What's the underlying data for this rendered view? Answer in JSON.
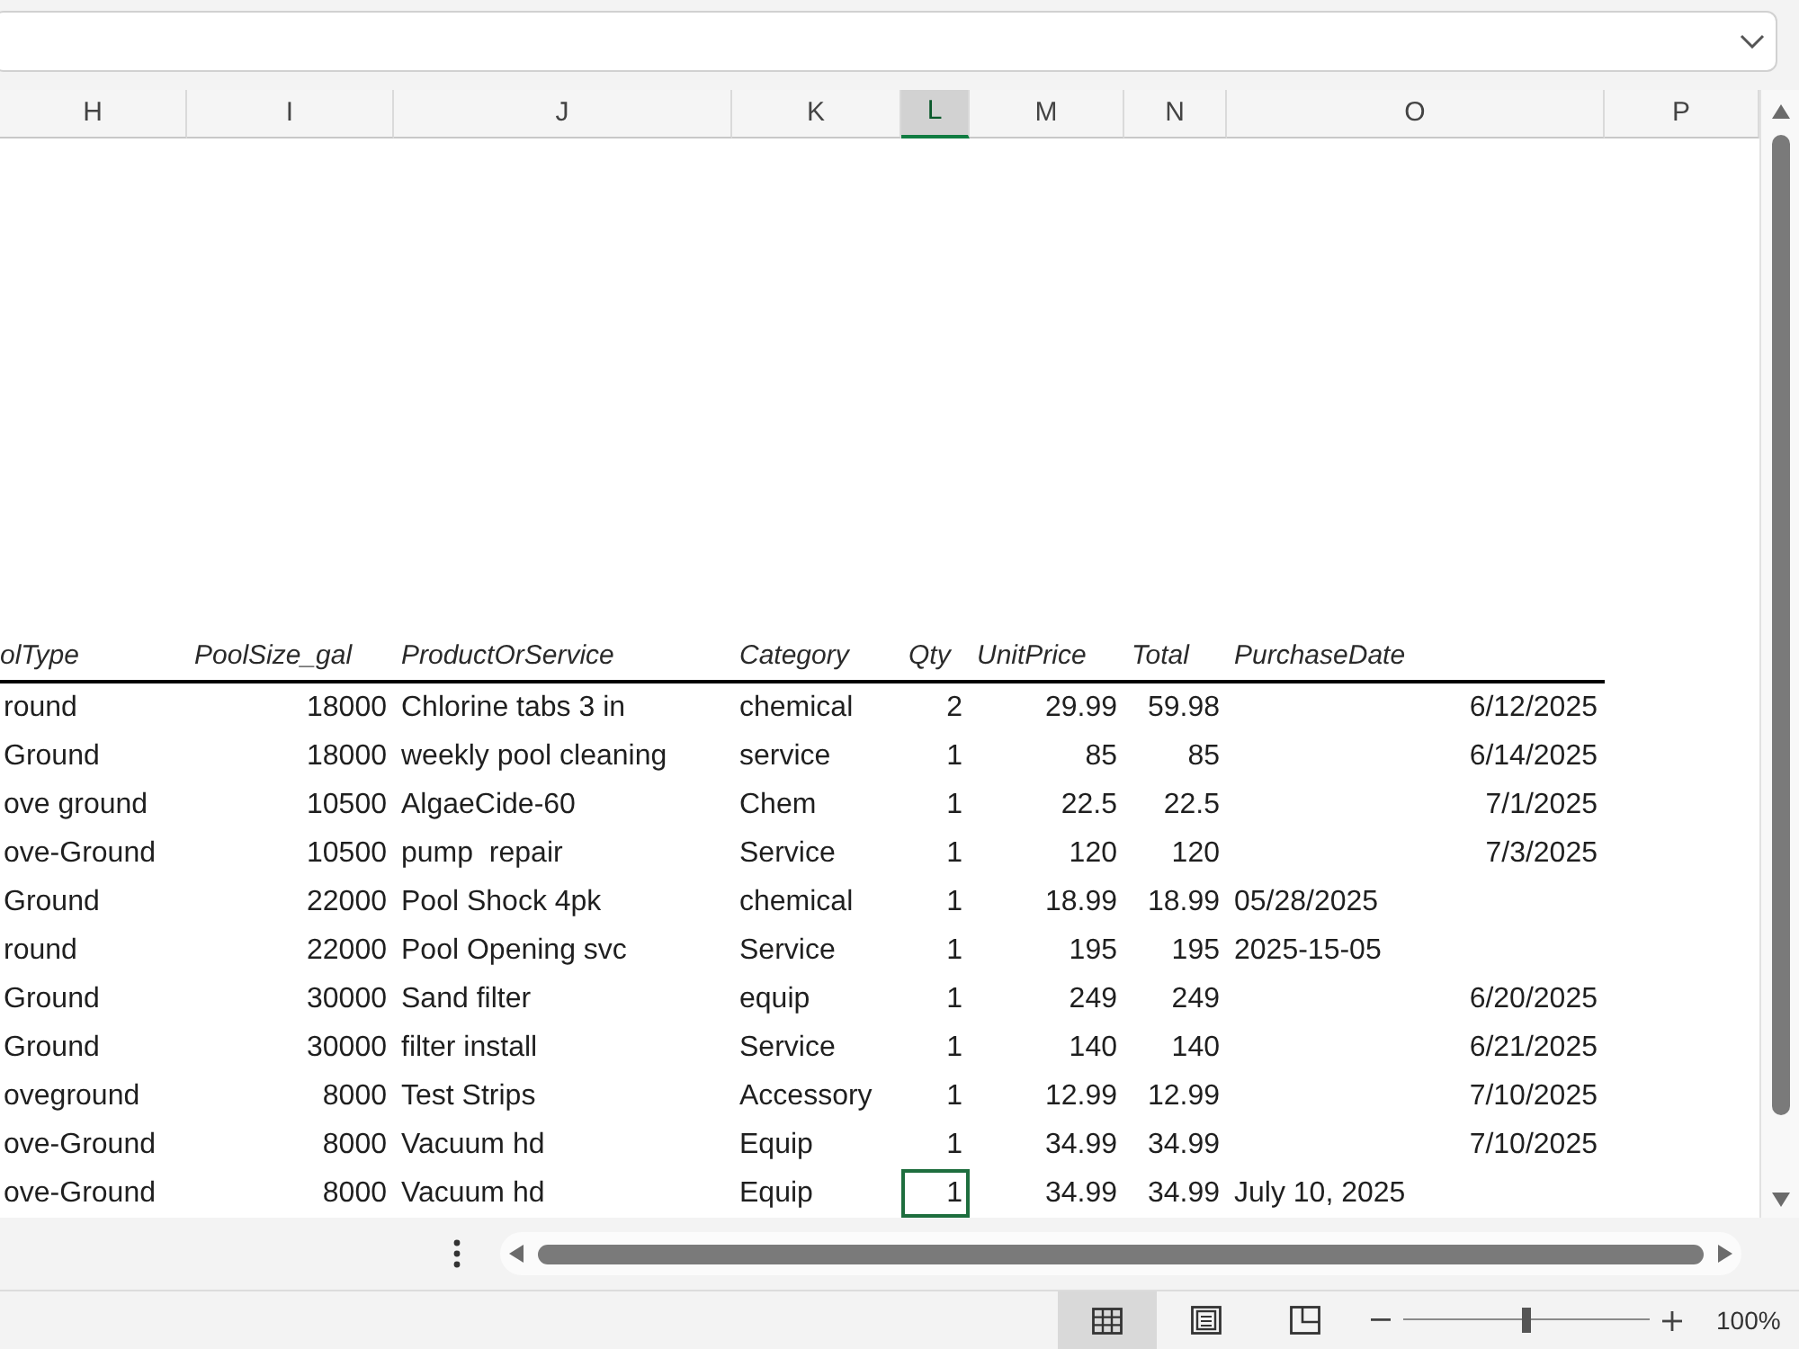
{
  "column_headers": [
    {
      "label": "H",
      "selected": false
    },
    {
      "label": "I",
      "selected": false
    },
    {
      "label": "J",
      "selected": false
    },
    {
      "label": "K",
      "selected": false
    },
    {
      "label": "L",
      "selected": true
    },
    {
      "label": "M",
      "selected": false
    },
    {
      "label": "N",
      "selected": false
    },
    {
      "label": "O",
      "selected": false
    },
    {
      "label": "P",
      "selected": false
    }
  ],
  "table": {
    "columns": [
      "olType",
      "PoolSize_gal",
      "ProductOrService",
      "Category",
      "Qty",
      "UnitPrice",
      "Total",
      "PurchaseDate"
    ],
    "rows": [
      [
        {
          "text": "round",
          "kind": "text",
          "selected": false
        },
        {
          "text": "18000",
          "kind": "number",
          "selected": false
        },
        {
          "text": "Chlorine tabs 3 in",
          "kind": "text",
          "selected": false
        },
        {
          "text": "chemical",
          "kind": "text",
          "selected": false
        },
        {
          "text": "2",
          "kind": "number",
          "selected": false
        },
        {
          "text": "29.99",
          "kind": "number",
          "selected": false
        },
        {
          "text": "59.98",
          "kind": "number",
          "selected": false
        },
        {
          "text": "6/12/2025",
          "kind": "number",
          "selected": false
        }
      ],
      [
        {
          "text": "Ground",
          "kind": "text",
          "selected": false
        },
        {
          "text": "18000",
          "kind": "number",
          "selected": false
        },
        {
          "text": "weekly pool cleaning",
          "kind": "text",
          "selected": false
        },
        {
          "text": "service",
          "kind": "text",
          "selected": false
        },
        {
          "text": "1",
          "kind": "number",
          "selected": false
        },
        {
          "text": "85",
          "kind": "number",
          "selected": false
        },
        {
          "text": "85",
          "kind": "number",
          "selected": false
        },
        {
          "text": "6/14/2025",
          "kind": "number",
          "selected": false
        }
      ],
      [
        {
          "text": "ove ground",
          "kind": "text",
          "selected": false
        },
        {
          "text": "10500",
          "kind": "number",
          "selected": false
        },
        {
          "text": "AlgaeCide-60",
          "kind": "text",
          "selected": false
        },
        {
          "text": "Chem",
          "kind": "text",
          "selected": false
        },
        {
          "text": "1",
          "kind": "number",
          "selected": false
        },
        {
          "text": "22.5",
          "kind": "number",
          "selected": false
        },
        {
          "text": "22.5",
          "kind": "number",
          "selected": false
        },
        {
          "text": "7/1/2025",
          "kind": "number",
          "selected": false
        }
      ],
      [
        {
          "text": "ove-Ground",
          "kind": "text",
          "selected": false
        },
        {
          "text": "10500",
          "kind": "number",
          "selected": false
        },
        {
          "text": "pump  repair",
          "kind": "text",
          "selected": false
        },
        {
          "text": "Service",
          "kind": "text",
          "selected": false
        },
        {
          "text": "1",
          "kind": "number",
          "selected": false
        },
        {
          "text": "120",
          "kind": "number",
          "selected": false
        },
        {
          "text": "120",
          "kind": "number",
          "selected": false
        },
        {
          "text": "7/3/2025",
          "kind": "number",
          "selected": false
        }
      ],
      [
        {
          "text": "Ground",
          "kind": "text",
          "selected": false
        },
        {
          "text": "22000",
          "kind": "number",
          "selected": false
        },
        {
          "text": "Pool Shock 4pk",
          "kind": "text",
          "selected": false
        },
        {
          "text": "chemical",
          "kind": "text",
          "selected": false
        },
        {
          "text": "1",
          "kind": "number",
          "selected": false
        },
        {
          "text": "18.99",
          "kind": "number",
          "selected": false
        },
        {
          "text": "18.99",
          "kind": "number",
          "selected": false
        },
        {
          "text": "05/28/2025",
          "kind": "text",
          "selected": false
        }
      ],
      [
        {
          "text": "round",
          "kind": "text",
          "selected": false
        },
        {
          "text": "22000",
          "kind": "number",
          "selected": false
        },
        {
          "text": "Pool Opening svc",
          "kind": "text",
          "selected": false
        },
        {
          "text": "Service",
          "kind": "text",
          "selected": false
        },
        {
          "text": "1",
          "kind": "number",
          "selected": false
        },
        {
          "text": "195",
          "kind": "number",
          "selected": false
        },
        {
          "text": "195",
          "kind": "number",
          "selected": false
        },
        {
          "text": "2025-15-05",
          "kind": "text",
          "selected": false
        }
      ],
      [
        {
          "text": "Ground",
          "kind": "text",
          "selected": false
        },
        {
          "text": "30000",
          "kind": "number",
          "selected": false
        },
        {
          "text": "Sand filter",
          "kind": "text",
          "selected": false
        },
        {
          "text": "equip",
          "kind": "text",
          "selected": false
        },
        {
          "text": "1",
          "kind": "number",
          "selected": false
        },
        {
          "text": "249",
          "kind": "number",
          "selected": false
        },
        {
          "text": "249",
          "kind": "number",
          "selected": false
        },
        {
          "text": "6/20/2025",
          "kind": "number",
          "selected": false
        }
      ],
      [
        {
          "text": "Ground",
          "kind": "text",
          "selected": false
        },
        {
          "text": "30000",
          "kind": "number",
          "selected": false
        },
        {
          "text": "filter install",
          "kind": "text",
          "selected": false
        },
        {
          "text": "Service",
          "kind": "text",
          "selected": false
        },
        {
          "text": "1",
          "kind": "number",
          "selected": false
        },
        {
          "text": "140",
          "kind": "number",
          "selected": false
        },
        {
          "text": "140",
          "kind": "number",
          "selected": false
        },
        {
          "text": "6/21/2025",
          "kind": "number",
          "selected": false
        }
      ],
      [
        {
          "text": "oveground",
          "kind": "text",
          "selected": false
        },
        {
          "text": "8000",
          "kind": "number",
          "selected": false
        },
        {
          "text": "Test Strips",
          "kind": "text",
          "selected": false
        },
        {
          "text": "Accessory",
          "kind": "text",
          "selected": false
        },
        {
          "text": "1",
          "kind": "number",
          "selected": false
        },
        {
          "text": "12.99",
          "kind": "number",
          "selected": false
        },
        {
          "text": "12.99",
          "kind": "number",
          "selected": false
        },
        {
          "text": "7/10/2025",
          "kind": "number",
          "selected": false
        }
      ],
      [
        {
          "text": "ove-Ground",
          "kind": "text",
          "selected": false
        },
        {
          "text": "8000",
          "kind": "number",
          "selected": false
        },
        {
          "text": "Vacuum hd",
          "kind": "text",
          "selected": false
        },
        {
          "text": "Equip",
          "kind": "text",
          "selected": false
        },
        {
          "text": "1",
          "kind": "number",
          "selected": false
        },
        {
          "text": "34.99",
          "kind": "number",
          "selected": false
        },
        {
          "text": "34.99",
          "kind": "number",
          "selected": false
        },
        {
          "text": "7/10/2025",
          "kind": "number",
          "selected": false
        }
      ],
      [
        {
          "text": "ove-Ground",
          "kind": "text",
          "selected": false
        },
        {
          "text": "8000",
          "kind": "number",
          "selected": false
        },
        {
          "text": "Vacuum hd",
          "kind": "text",
          "selected": false
        },
        {
          "text": "Equip",
          "kind": "text",
          "selected": false
        },
        {
          "text": "1",
          "kind": "number",
          "selected": true
        },
        {
          "text": "34.99",
          "kind": "number",
          "selected": false
        },
        {
          "text": "34.99",
          "kind": "number",
          "selected": false
        },
        {
          "text": "July 10, 2025",
          "kind": "text",
          "selected": false
        }
      ]
    ]
  },
  "status_bar": {
    "views": [
      {
        "kind": "normal",
        "selected": true
      },
      {
        "kind": "page_layout",
        "selected": false
      },
      {
        "kind": "page_break",
        "selected": false
      }
    ],
    "zoom": {
      "level": 0.5,
      "label": "100%"
    }
  }
}
